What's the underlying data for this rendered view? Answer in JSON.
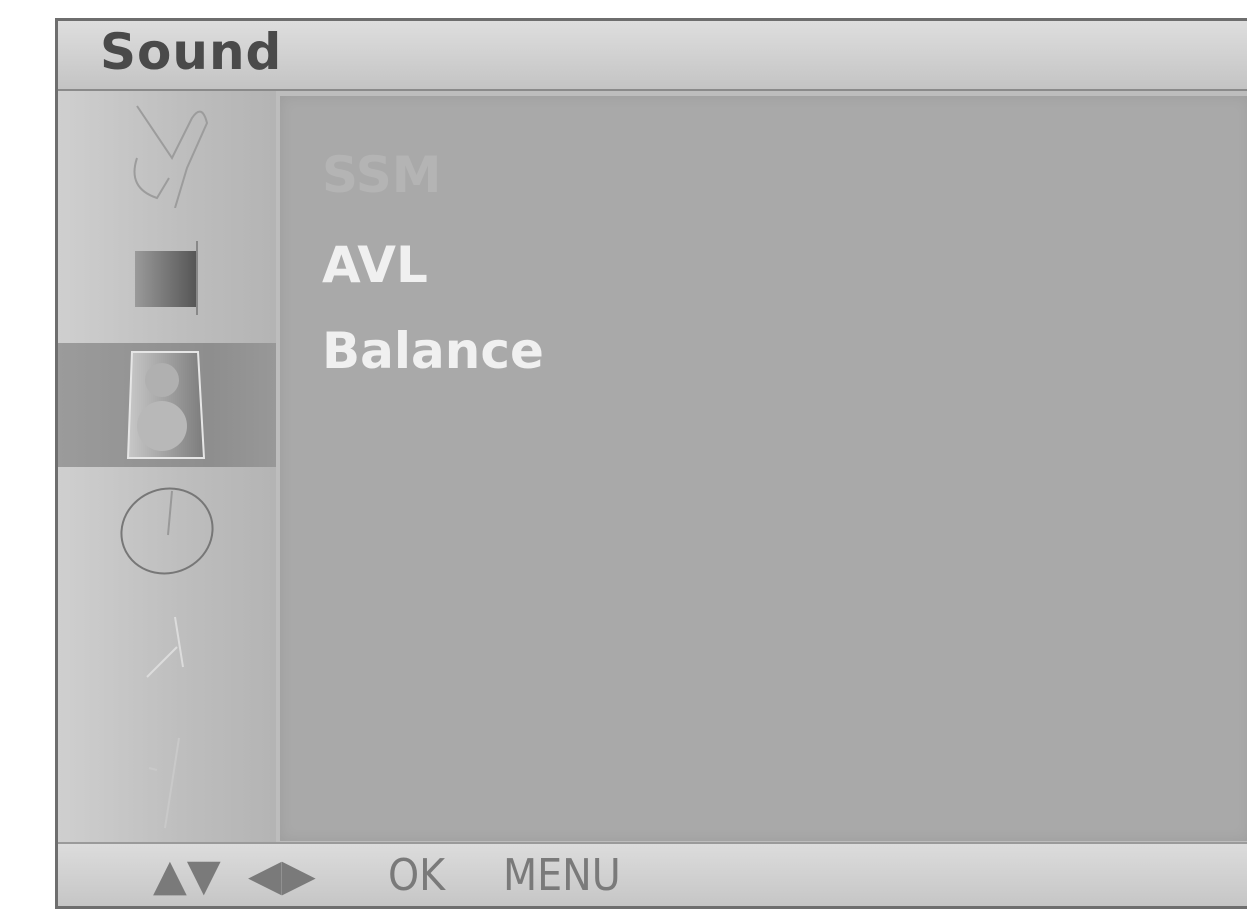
{
  "title": "Sound",
  "sidebar": {
    "icons": [
      {
        "name": "station-icon",
        "selected": false
      },
      {
        "name": "picture-icon",
        "selected": false
      },
      {
        "name": "speaker-icon",
        "selected": true
      },
      {
        "name": "time-icon",
        "selected": false
      },
      {
        "name": "special-icon",
        "selected": false
      },
      {
        "name": "screen-icon",
        "selected": false
      }
    ]
  },
  "menu": {
    "items": [
      {
        "label": "SSM",
        "state": "disabled"
      },
      {
        "label": "AVL",
        "state": "enabled"
      },
      {
        "label": "Balance",
        "state": "enabled"
      }
    ]
  },
  "navbar": {
    "updown_glyph": "▲▼",
    "leftright_glyph": "◀▶",
    "ok_label": "OK",
    "menu_label": "MENU"
  }
}
